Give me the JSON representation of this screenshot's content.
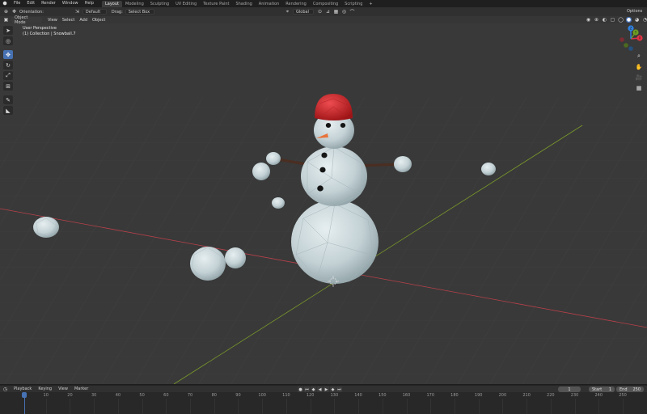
{
  "topbar": {
    "menus": [
      "File",
      "Edit",
      "Render",
      "Window",
      "Help"
    ],
    "workspaces": [
      "Layout",
      "Modeling",
      "Sculpting",
      "UV Editing",
      "Texture Paint",
      "Shading",
      "Animation",
      "Rendering",
      "Compositing",
      "Scripting"
    ],
    "active_workspace": "Layout",
    "add_workspace": "+"
  },
  "toolrow": {
    "orientation_label": "Orientation:",
    "orientation_value": "Default",
    "drag_label": "Drag:",
    "drag_value": "Select Box",
    "transform_orientation": "Global",
    "options_label": "Options"
  },
  "viewhead": {
    "mode": "Object Mode",
    "menus": [
      "View",
      "Select",
      "Add",
      "Object"
    ]
  },
  "overlay": {
    "line1": "User Perspective",
    "line2": "(1) Collection | Snowball.7"
  },
  "gizmo": {
    "x_label": "X",
    "y_label": "Y",
    "z_label": "Z",
    "x_color": "#e03344",
    "y_color": "#6ea022",
    "z_color": "#2f83e3"
  },
  "timeline": {
    "menus": [
      "Playback",
      "Keying",
      "View",
      "Marker"
    ],
    "current_frame": "1",
    "start_label": "Start",
    "start_value": "1",
    "end_label": "End",
    "end_value": "250",
    "frame_ticks": [
      "1",
      "10",
      "20",
      "30",
      "40",
      "50",
      "60",
      "70",
      "80",
      "90",
      "100",
      "110",
      "120",
      "130",
      "140",
      "150",
      "160",
      "170",
      "180",
      "190",
      "200",
      "210",
      "220",
      "230",
      "240",
      "250"
    ]
  },
  "colors": {
    "accent": "#4772b3",
    "x_axis": "#b8404a",
    "y_axis": "#7a9a2a",
    "snow": "#cfdcdf",
    "hat": "#d42a2e",
    "carrot": "#e8733c"
  }
}
